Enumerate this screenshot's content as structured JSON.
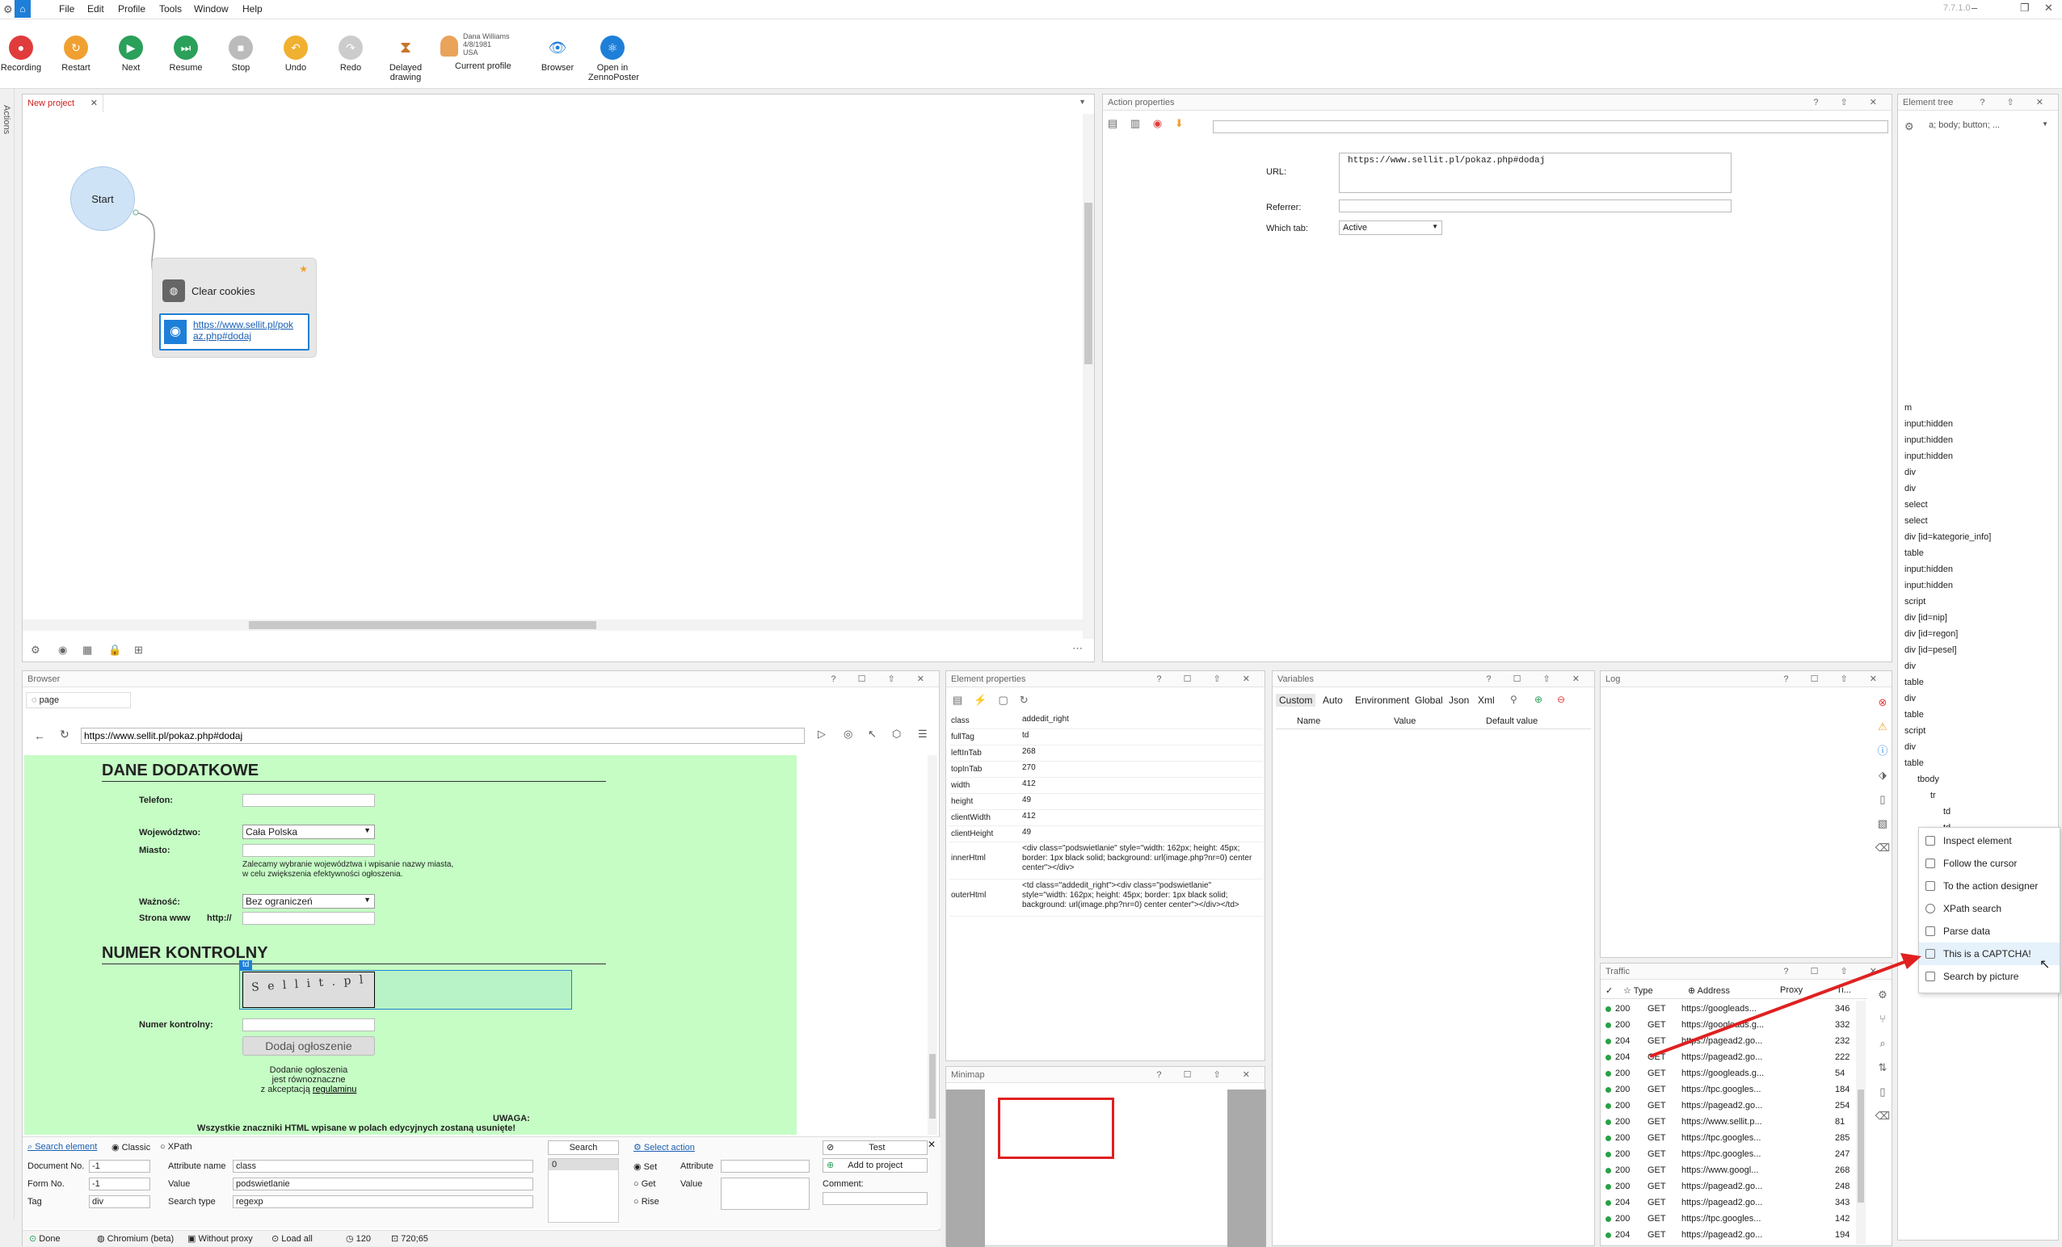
{
  "app": {
    "version": "7.7.1.0"
  },
  "menu": [
    "File",
    "Edit",
    "Profile",
    "Tools",
    "Window",
    "Help"
  ],
  "toolbar": {
    "recording": "Recording",
    "restart": "Restart",
    "next": "Next",
    "resume": "Resume",
    "stop": "Stop",
    "undo": "Undo",
    "redo": "Redo",
    "delayed": "Delayed drawing",
    "profile_name": "Dana Williams",
    "profile_dob": "4/8/1981",
    "profile_country": "USA",
    "current_profile": "Current profile",
    "browser": "Browser",
    "open_zp": "Open in ZennoPoster"
  },
  "side_tab": "Actions",
  "project": {
    "tab": "New project",
    "start": "Start",
    "node_title": "Clear cookies",
    "node_url": "https://www.sellit.pl/pokaz.php#dodaj"
  },
  "action_props": {
    "title": "Action properties",
    "url_label": "URL:",
    "url_value": "https://www.sellit.pl/pokaz.php#dodaj",
    "referrer_label": "Referrer:",
    "which_tab_label": "Which tab:",
    "which_tab_value": "Active"
  },
  "element_tree": {
    "title": "Element tree",
    "filter": "a; body; button; ...",
    "items": [
      "m",
      "input:hidden",
      "input:hidden",
      "input:hidden",
      "div",
      "div",
      "select",
      "select",
      "div [id=kategorie_info]",
      "table",
      "input:hidden",
      "input:hidden",
      "script",
      "div [id=nip]",
      "div [id=regon]",
      "div [id=pesel]",
      "div",
      "table",
      "div",
      "table",
      "script",
      "div",
      "table",
      "tbody",
      "tr",
      "td",
      "td"
    ]
  },
  "context_menu": [
    "Inspect element",
    "Follow the cursor",
    "To the action designer",
    "XPath search",
    "Parse data",
    "This is a CAPTCHA!",
    "Search by picture"
  ],
  "browser": {
    "title": "Browser",
    "tab": "page",
    "address": "https://www.sellit.pl/pokaz.php#dodaj",
    "page": {
      "h1": "DANE DODATKOWE",
      "telefon": "Telefon:",
      "woj": "Województwo:",
      "woj_val": "Cała Polska",
      "miasto": "Miasto:",
      "hint1": "Zalecamy wybranie województwa i wpisanie nazwy miasta,",
      "hint2": "w celu zwiększenia efektywności ogłoszenia.",
      "waznosc": "Ważność:",
      "waznosc_val": "Bez ograniczeń",
      "www": "Strona www",
      "http": "http://",
      "h2": "NUMER KONTROLNY",
      "td": "td",
      "captcha_text": "S e l l i t . p l",
      "nr": "Numer kontrolny:",
      "submit": "Dodaj ogłoszenie",
      "p1": "Dodanie ogłoszenia",
      "p2": "jest równoznaczne",
      "p3": "z akceptacją",
      "p3link": "regulaminu",
      "uwaga": "UWAGA:",
      "uwaga2": "Wszystkie znaczniki HTML wpisane w polach edycyjnych zostaną usunięte!"
    },
    "search": {
      "search_element": "Search element",
      "classic": "Classic",
      "xpath": "XPath",
      "docno": "Document No.",
      "docno_val": "-1",
      "formno": "Form No.",
      "formno_val": "-1",
      "tag": "Tag",
      "tag_val": "div",
      "attr_name": "Attribute name",
      "attr_val": "class",
      "value": "Value",
      "value_val": "podswietlanie",
      "search_type": "Search type",
      "search_type_val": "regexp",
      "search_btn": "Search",
      "result": "0",
      "select_action": "Select action",
      "set": "Set",
      "get": "Get",
      "rise": "Rise",
      "attribute": "Attribute",
      "value2": "Value",
      "test": "Test",
      "add": "Add to project",
      "comment": "Comment:"
    },
    "status": {
      "done": "Done",
      "chromium": "Chromium (beta)",
      "proxy": "Without proxy",
      "load": "Load all",
      "num": "120",
      "size": "720;65"
    }
  },
  "element_props": {
    "title": "Element properties",
    "rows": [
      [
        "class",
        "addedit_right"
      ],
      [
        "fullTag",
        "td"
      ],
      [
        "leftInTab",
        "268"
      ],
      [
        "topInTab",
        "270"
      ],
      [
        "width",
        "412"
      ],
      [
        "height",
        "49"
      ],
      [
        "clientWidth",
        "412"
      ],
      [
        "clientHeight",
        "49"
      ],
      [
        "innerHtml",
        "<div class=\"podswietlanie\" style=\"width: 162px; height: 45px; border: 1px black solid; background: url(image.php?nr=0) center center\"></div>"
      ],
      [
        "outerHtml",
        "<td class=\"addedit_right\"><div class=\"podswietlanie\" style=\"width: 162px; height: 45px; border: 1px black solid; background: url(image.php?nr=0) center center\"></div></td>"
      ]
    ]
  },
  "variables": {
    "title": "Variables",
    "tabs": [
      "Custom",
      "Auto",
      "Environment",
      "Global",
      "Json",
      "Xml"
    ],
    "cols": [
      "Name",
      "Value",
      "Default value"
    ]
  },
  "log": {
    "title": "Log"
  },
  "minimap": {
    "title": "Minimap"
  },
  "traffic": {
    "title": "Traffic",
    "cols": [
      "Type",
      "Address",
      "Proxy",
      "Ti..."
    ],
    "rows": [
      [
        "200",
        "GET",
        "https://googleads...",
        "346"
      ],
      [
        "200",
        "GET",
        "https://googleads.g...",
        "332"
      ],
      [
        "204",
        "GET",
        "https://pagead2.go...",
        "232"
      ],
      [
        "204",
        "GET",
        "https://pagead2.go...",
        "222"
      ],
      [
        "200",
        "GET",
        "https://googleads.g...",
        "54"
      ],
      [
        "200",
        "GET",
        "https://tpc.googles...",
        "184"
      ],
      [
        "200",
        "GET",
        "https://pagead2.go...",
        "254"
      ],
      [
        "200",
        "GET",
        "https://www.sellit.p...",
        "81"
      ],
      [
        "200",
        "GET",
        "https://tpc.googles...",
        "285"
      ],
      [
        "200",
        "GET",
        "https://tpc.googles...",
        "247"
      ],
      [
        "200",
        "GET",
        "https://www.googl...",
        "268"
      ],
      [
        "200",
        "GET",
        "https://pagead2.go...",
        "248"
      ],
      [
        "204",
        "GET",
        "https://pagead2.go...",
        "343"
      ],
      [
        "200",
        "GET",
        "https://tpc.googles...",
        "142"
      ],
      [
        "204",
        "GET",
        "https://pagead2.go...",
        "194"
      ]
    ]
  }
}
